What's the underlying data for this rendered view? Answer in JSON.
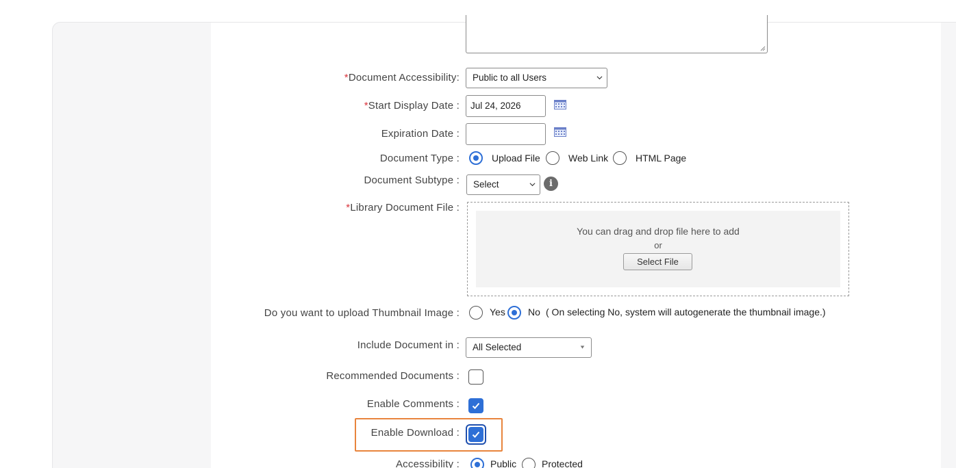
{
  "form": {
    "accessibility": {
      "label": "Document Accessibility:",
      "value": "Public to all Users"
    },
    "start_date": {
      "label": "Start Display Date :",
      "value": "Jul 24, 2026"
    },
    "expiration_date": {
      "label": "Expiration Date :",
      "value": ""
    },
    "document_type": {
      "label": "Document Type :",
      "options": [
        "Upload File",
        "Web Link",
        "HTML Page"
      ],
      "selected": "Upload File"
    },
    "document_subtype": {
      "label": "Document Subtype :",
      "value": "Select"
    },
    "library_file": {
      "label": "Library Document File :",
      "drop_text": "You can drag and drop file here to add",
      "or_text": "or",
      "button": "Select File"
    },
    "thumbnail": {
      "label": "Do you want to upload Thumbnail Image :",
      "options": [
        "Yes",
        "No"
      ],
      "selected": "No",
      "note": "( On selecting No, system will autogenerate the thumbnail image.)"
    },
    "include_in": {
      "label": "Include Document in :",
      "value": "All Selected"
    },
    "recommended": {
      "label": "Recommended Documents :",
      "checked": false
    },
    "comments": {
      "label": "Enable Comments :",
      "checked": true
    },
    "download": {
      "label": "Enable Download :",
      "checked": true
    },
    "access": {
      "label": "Accessibility :",
      "options": [
        "Public",
        "Protected"
      ],
      "selected": "Public"
    },
    "required_mark": "*"
  },
  "colors": {
    "accent": "#2e6fd6",
    "required": "#d9363e",
    "highlight": "#e8843c"
  }
}
